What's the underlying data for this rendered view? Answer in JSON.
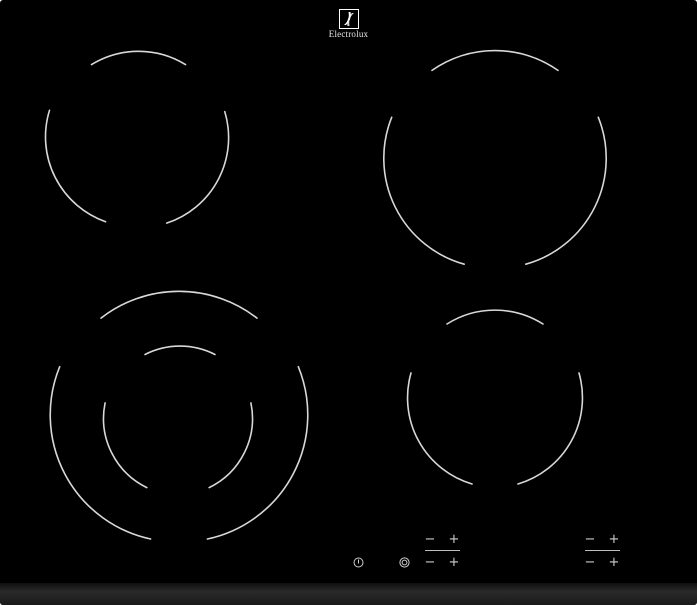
{
  "brand": {
    "name": "Electrolux",
    "logo_icon": "electrolux-logo-icon"
  },
  "colors": {
    "glass": "#000000",
    "zone_outline": "#d8d8d8",
    "controls": "#d0d0d0"
  },
  "cooking_zones": [
    {
      "id": "front-left",
      "type": "dual-zone",
      "rings": 2
    },
    {
      "id": "rear-left",
      "type": "single-zone",
      "rings": 1
    },
    {
      "id": "rear-right",
      "type": "single-zone",
      "rings": 1
    },
    {
      "id": "front-right",
      "type": "single-zone",
      "rings": 1
    }
  ],
  "controls": {
    "power_icon": "power-icon",
    "dual_zone_icon": "dual-zone-icon",
    "minus_label": "−",
    "plus_label": "+"
  }
}
